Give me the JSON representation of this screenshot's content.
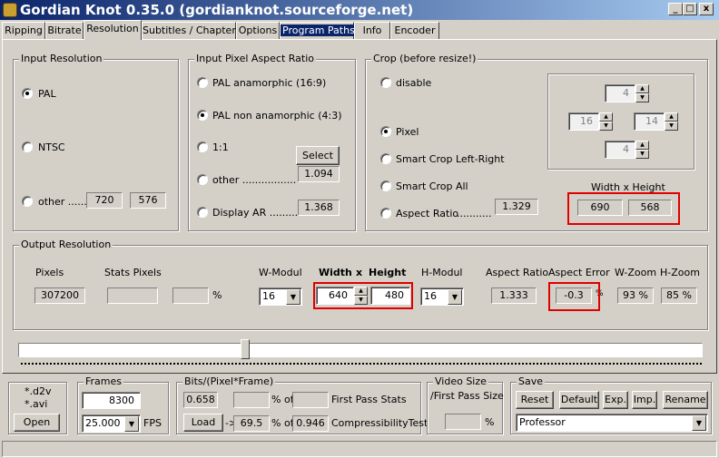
{
  "window": {
    "title": "Gordian Knot 0.35.0  (gordianknot.sourceforge.net)",
    "min": "_",
    "max": "□",
    "close": "x"
  },
  "tabs": [
    "Ripping",
    "Bitrate",
    "Resolution",
    "Subtitles / Chapters",
    "Options",
    "Program Paths",
    "Info",
    "Encoder"
  ],
  "input_resolution": {
    "title": "Input Resolution",
    "pal": "PAL",
    "ntsc": "NTSC",
    "other": "other .......",
    "other_w": "720",
    "other_h": "576"
  },
  "pixel_aspect": {
    "title": "Input Pixel Aspect Ratio",
    "pal_anamorphic": "PAL anamorphic (16:9)",
    "pal_non_anamorphic": "PAL non anamorphic (4:3)",
    "one_one": "1:1",
    "other": "other .................",
    "display_ar": "Display AR .........",
    "select": "Select",
    "other_value": "1.094",
    "display_value": "1.368"
  },
  "crop": {
    "title": "Crop (before resize!)",
    "disable": "disable",
    "pixel": "Pixel",
    "smart_lr": "Smart Crop Left-Right",
    "smart_all": "Smart Crop All",
    "aspect_ratio": "Aspect Ratio",
    "aspect_value": "1.329",
    "top": "4",
    "left": "16",
    "right": "14",
    "bottom": "4",
    "wh_label": "Width x Height",
    "width": "690",
    "height": "568"
  },
  "output": {
    "title": "Output Resolution",
    "pixels_label": "Pixels",
    "pixels": "307200",
    "stats_label": "Stats Pixels",
    "stats": "",
    "stats_pct": "",
    "pct": "%",
    "wmodul_label": "W-Modul",
    "wmodul": "16",
    "width_label": "Width",
    "x": "x",
    "height_label": "Height",
    "width": "640",
    "height": "480",
    "hmodul_label": "H-Modul",
    "hmodul": "16",
    "ar_label": "Aspect Ratio",
    "ar": "1.333",
    "ae_label": "Aspect Error",
    "ae": "-0.3",
    "ae_pct": "%",
    "wzoom_label": "W-Zoom",
    "wzoom": "93 %",
    "hzoom_label": "H-Zoom",
    "hzoom": "85 %"
  },
  "files": {
    "d2v": "*.d2v",
    "avi": "*.avi",
    "open": "Open"
  },
  "frames": {
    "title": "Frames",
    "count": "8300",
    "fps_value": "25.000",
    "fps": "FPS"
  },
  "bits": {
    "title": "Bits/(Pixel*Frame)",
    "value": "0.658",
    "pct_of": "% of",
    "first_pass": "First Pass Stats",
    "load": "Load",
    "arrow": "->",
    "load_value": "69.5",
    "pct_of2": "% of",
    "comp_value": "0.946",
    "comp_test": "CompressibilityTest"
  },
  "video_size": {
    "title": "Video Size",
    "subtitle": "/First Pass Size",
    "pct": "%"
  },
  "save": {
    "title": "Save",
    "reset": "Reset",
    "default": "Default",
    "exp": "Exp.",
    "imp": "Imp.",
    "rename": "Rename",
    "profile": "Professor"
  },
  "colors": {
    "highlight": "#e00000",
    "title_bg": "#0a246a"
  }
}
